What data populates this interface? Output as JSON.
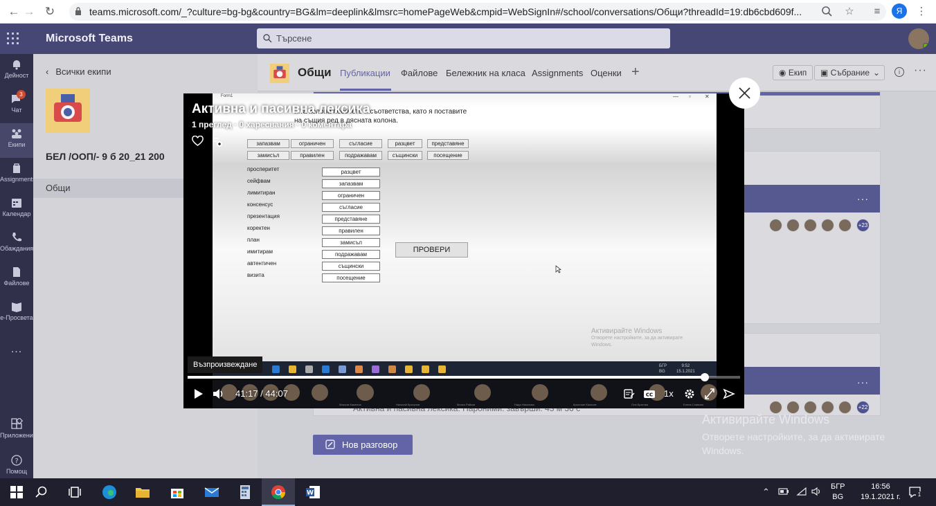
{
  "browser": {
    "url": "teams.microsoft.com/_?culture=bg-bg&country=BG&lm=deeplink&lmsrc=homePageWeb&cmpid=WebSignIn#/school/conversations/Общи?threadId=19:db6cbd609f...",
    "profile_initial": "Я"
  },
  "teams": {
    "brand": "Microsoft Teams",
    "search_placeholder": "Търсене"
  },
  "rail": {
    "items": [
      {
        "label": "Дейност",
        "icon": "bell-icon"
      },
      {
        "label": "Чат",
        "icon": "chat-icon",
        "badge": "3"
      },
      {
        "label": "Екипи",
        "icon": "teams-icon"
      },
      {
        "label": "Assignments",
        "icon": "assignments-icon"
      },
      {
        "label": "Календар",
        "icon": "calendar-icon"
      },
      {
        "label": "Обаждания",
        "icon": "phone-icon"
      },
      {
        "label": "Файлове",
        "icon": "files-icon"
      },
      {
        "label": "e-Просвета",
        "icon": "book-icon"
      },
      {
        "label": "...",
        "icon": "more-icon"
      },
      {
        "label": "Приложения",
        "icon": "apps-icon"
      },
      {
        "label": "Помощ",
        "icon": "help-icon"
      }
    ]
  },
  "team_panel": {
    "back_label": "Всички екипи",
    "team_name": "БЕЛ /ООП/- 9 б 20_21 200",
    "channel": "Общи"
  },
  "channel": {
    "name": "Общи",
    "tabs": [
      "Публикации",
      "Файлове",
      "Бележник на класа",
      "Assignments",
      "Оценки"
    ],
    "team_button": "Екип",
    "meet_button": "Събрание",
    "avatar_count_1": "+23",
    "avatar_count_2": "+22",
    "faded_post": "Активна и пасивна лексика. Пароними. завърши: 43 м 36 с",
    "new_conversation": "Нов разговор"
  },
  "windows_activation": {
    "title": "Активирайте Windows",
    "subtitle_line1": "Отворете настройките, за да активирате",
    "subtitle_line2": "Windows."
  },
  "player": {
    "title": "Активна и пасивна лексика",
    "meta": "1 преглед · 0 харесвания · 0 коментара",
    "tooltip": "Възпроизвеждане",
    "current_time": "41:17",
    "separator": "/",
    "total_time": "44:07",
    "progress": 0.936,
    "speed": "1x",
    "video": {
      "window_title": "Form1",
      "instruction": "...та колона посочете ...съответства, като я поставите на същия ред в дясната колона.",
      "words_row1": [
        "запазвам",
        "ограничен",
        "съгласие",
        "разцвет",
        "представяне"
      ],
      "words_row2": [
        "замисъл",
        "правилен",
        "подражавам",
        "същински",
        "посещение"
      ],
      "pairs": [
        {
          "left": "просперитет",
          "right": "разцвет"
        },
        {
          "left": "сейфвам",
          "right": "запазвам"
        },
        {
          "left": "лимитиран",
          "right": "ограничен"
        },
        {
          "left": "консенсус",
          "right": "съгласие"
        },
        {
          "left": "презентация",
          "right": "представяне"
        },
        {
          "left": "коректен",
          "right": "правилен"
        },
        {
          "left": "план",
          "right": "замисъл"
        },
        {
          "left": "имитирам",
          "right": "подражавам"
        },
        {
          "left": "автентичен",
          "right": "същински"
        },
        {
          "left": "визита",
          "right": "посещение"
        }
      ],
      "check_button": "ПРОВЕРИ",
      "activate_title": "Активирайте Windows",
      "activate_sub": "Отворете настройките, за да активирате Windows.",
      "clock_time": "9:52",
      "clock_date": "15.1.2021",
      "lang_top": "БГР",
      "lang_bottom": "BG"
    },
    "participants": [
      "Максим Каменов",
      "Николай Крачунов",
      "Милко Райков",
      "Надя Николова",
      "Кристиан Кальчев",
      "Оля Братова",
      "Елена Славова"
    ]
  },
  "taskbar": {
    "lang_top": "БГР",
    "lang_bottom": "BG",
    "time": "16:56",
    "date": "19.1.2021 г.",
    "notifications": "1"
  }
}
